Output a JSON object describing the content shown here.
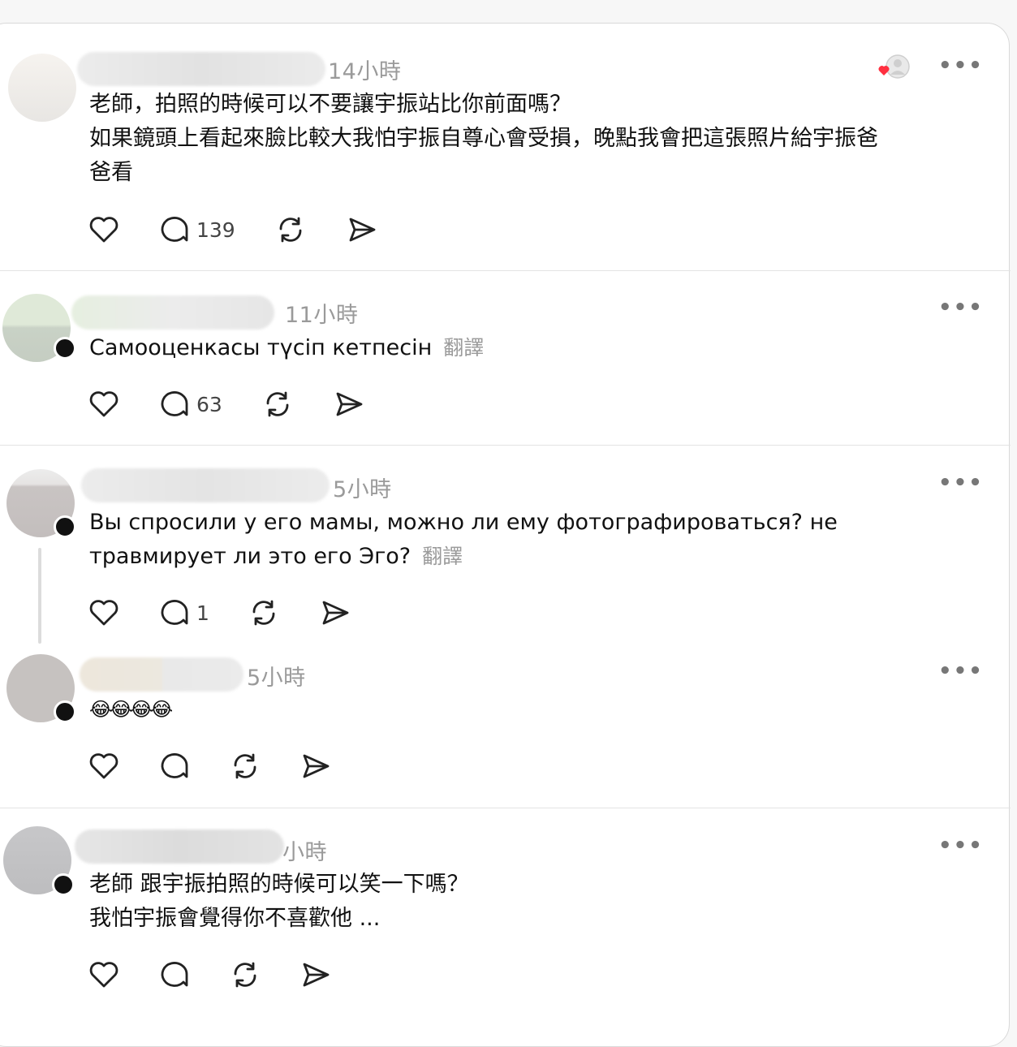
{
  "posts": [
    {
      "time": "14小時",
      "lines": [
        "老師，拍照的時候可以不要讓宇振站比你前面嗎？",
        "如果鏡頭上看起來臉比較大我怕宇振自尊心會受損，晚點我會把這張照片給宇振爸",
        "爸看"
      ],
      "translate": "",
      "reply_count": "139",
      "liked_by_author": true
    },
    {
      "time": "11小時",
      "lines": [
        "Самооценкасы түсіп кетпесін"
      ],
      "translate": "翻譯",
      "reply_count": "63"
    },
    {
      "time": "5小時",
      "lines": [
        "Вы спросили у его мамы, можно ли ему фотографироваться? не",
        "травмирует ли это его Эго?"
      ],
      "translate": "翻譯",
      "reply_count": "1"
    },
    {
      "time": "5小時",
      "lines": [
        "😂😂😂😂"
      ],
      "translate": "",
      "reply_count": ""
    },
    {
      "time": "小時",
      "lines": [
        "老師 跟宇振拍照的時候可以笑一下嗎？",
        "我怕宇振會覺得你不喜歡他 ..."
      ],
      "translate": "",
      "reply_count": ""
    }
  ],
  "more_label": "•••",
  "icons": {
    "like": "heart-icon",
    "reply": "comment-icon",
    "repost": "repost-icon",
    "share": "send-icon"
  },
  "colors": {
    "like_red": "#ff3040",
    "muted": "#9a9a9a"
  }
}
